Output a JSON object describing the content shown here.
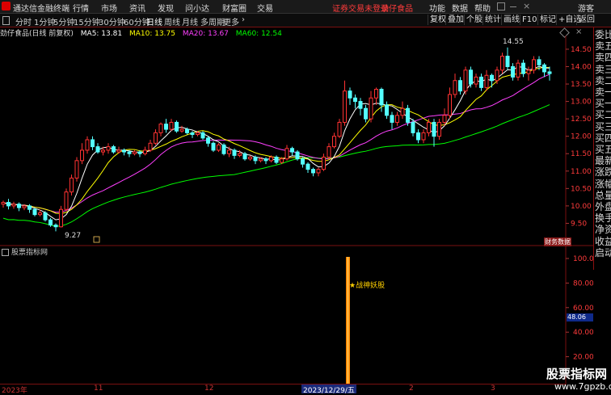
{
  "titlebar": {
    "app_title": "通达信金融终端",
    "menus": [
      "行情",
      "市场",
      "资讯",
      "发现",
      "问小达",
      "财富圈",
      "交易"
    ],
    "warning": "证券交易未登录",
    "stock_short": "劲仔食品",
    "right_items": [
      "功能",
      "数据",
      "帮助"
    ],
    "guest": "游客"
  },
  "toolbar": {
    "periods": [
      "分时",
      "1分钟",
      "5分钟",
      "15分钟",
      "30分钟",
      "60分钟",
      "日线",
      "周线",
      "月线",
      "多周期",
      "更多"
    ],
    "active_period": "日线",
    "right_buttons": [
      "复权",
      "叠加",
      "个股",
      "统计",
      "画线",
      "F10",
      "标记",
      "+自选",
      "返回"
    ]
  },
  "chart_header": {
    "stock_label": "劲仔食品(日线 前复权)",
    "ma5": "MA5: 13.81",
    "ma10": "MA10: 13.75",
    "ma20": "MA20: 13.67",
    "ma60": "MA60: 12.54",
    "colors": {
      "ma5": "#ffffff",
      "ma10": "#ffff00",
      "ma20": "#ff40ff",
      "ma60": "#00ff00"
    }
  },
  "right_panel": [
    "委比",
    "卖五",
    "卖四",
    "卖三",
    "卖二",
    "卖一",
    "买一",
    "买二",
    "买三",
    "买四",
    "买五",
    "最新",
    "涨跌",
    "涨幅",
    "总量",
    "外盘",
    "换手",
    "净资",
    "收益",
    "启动"
  ],
  "price_axis": [
    "14.50",
    "14.00",
    "13.50",
    "13.00",
    "12.50",
    "12.00",
    "11.50",
    "11.00",
    "10.50",
    "10.00",
    "9.50"
  ],
  "price_annotations": {
    "high": "14.55",
    "low": "9.27"
  },
  "caibao": "财务数据",
  "indicator": {
    "title": "股票指标网",
    "signal_text": "★战神妖股",
    "axis": [
      "100.00",
      "80.00",
      "60.00",
      "40.00",
      "20.00"
    ],
    "current_value": "48.06"
  },
  "dates": {
    "start": "2023年",
    "m11": "11",
    "m12": "12",
    "highlight": "2023/12/29/五",
    "m2": "2",
    "m3": "3"
  },
  "watermark": {
    "name": "股票指标网",
    "url": "www.7gpzb.com"
  },
  "chart_data": {
    "type": "candlestick",
    "price_range": [
      9.0,
      14.8
    ],
    "candles": [
      [
        10.05,
        10.1,
        9.95,
        10.15
      ],
      [
        10.1,
        10.0,
        9.9,
        10.2
      ],
      [
        10.0,
        10.05,
        9.92,
        10.12
      ],
      [
        10.05,
        9.95,
        9.85,
        10.1
      ],
      [
        9.95,
        10.0,
        9.88,
        10.05
      ],
      [
        10.0,
        9.9,
        9.8,
        10.05
      ],
      [
        9.9,
        9.75,
        9.7,
        9.95
      ],
      [
        9.75,
        9.8,
        9.7,
        9.9
      ],
      [
        9.8,
        9.6,
        9.55,
        9.85
      ],
      [
        9.6,
        9.45,
        9.4,
        9.65
      ],
      [
        9.45,
        9.4,
        9.27,
        9.5
      ],
      [
        9.4,
        9.9,
        9.38,
        10.0
      ],
      [
        9.9,
        10.4,
        9.85,
        10.5
      ],
      [
        10.4,
        10.8,
        10.3,
        10.9
      ],
      [
        10.8,
        11.3,
        10.7,
        11.4
      ],
      [
        11.3,
        11.6,
        11.2,
        11.8
      ],
      [
        11.6,
        11.9,
        11.5,
        12.0
      ],
      [
        11.9,
        11.7,
        11.6,
        12.0
      ],
      [
        11.7,
        11.55,
        11.5,
        11.8
      ],
      [
        11.55,
        11.6,
        11.45,
        11.7
      ],
      [
        11.6,
        11.7,
        11.5,
        11.8
      ],
      [
        11.7,
        11.55,
        11.5,
        11.75
      ],
      [
        11.55,
        11.6,
        11.5,
        11.7
      ],
      [
        11.6,
        11.55,
        11.45,
        11.65
      ],
      [
        11.55,
        11.5,
        11.4,
        11.6
      ],
      [
        11.5,
        11.55,
        11.45,
        11.6
      ],
      [
        11.55,
        11.5,
        11.4,
        11.6
      ],
      [
        11.5,
        11.6,
        11.45,
        11.7
      ],
      [
        11.6,
        11.8,
        11.55,
        11.9
      ],
      [
        11.8,
        12.1,
        11.75,
        12.2
      ],
      [
        12.1,
        12.35,
        12.0,
        12.4
      ],
      [
        12.35,
        12.2,
        12.1,
        12.5
      ],
      [
        12.2,
        12.4,
        12.15,
        12.5
      ],
      [
        12.4,
        12.15,
        12.1,
        12.45
      ],
      [
        12.15,
        12.2,
        12.1,
        12.3
      ],
      [
        12.2,
        12.1,
        12.05,
        12.25
      ],
      [
        12.1,
        12.05,
        11.95,
        12.15
      ],
      [
        12.05,
        12.1,
        12.0,
        12.15
      ],
      [
        12.1,
        11.95,
        11.9,
        12.15
      ],
      [
        11.95,
        11.8,
        11.7,
        12.0
      ],
      [
        11.8,
        11.6,
        11.55,
        11.85
      ],
      [
        11.6,
        11.75,
        11.55,
        11.8
      ],
      [
        11.75,
        11.5,
        11.45,
        11.8
      ],
      [
        11.5,
        11.6,
        11.4,
        11.7
      ],
      [
        11.6,
        11.45,
        11.35,
        11.65
      ],
      [
        11.45,
        11.5,
        11.4,
        11.6
      ],
      [
        11.5,
        11.35,
        11.3,
        11.55
      ],
      [
        11.35,
        11.4,
        11.3,
        11.45
      ],
      [
        11.4,
        11.3,
        11.2,
        11.45
      ],
      [
        11.3,
        11.35,
        11.25,
        11.4
      ],
      [
        11.35,
        11.3,
        11.2,
        11.4
      ],
      [
        11.3,
        11.4,
        11.25,
        11.45
      ],
      [
        11.4,
        11.25,
        11.2,
        11.45
      ],
      [
        11.25,
        11.35,
        11.2,
        11.4
      ],
      [
        11.35,
        11.65,
        11.3,
        11.75
      ],
      [
        11.65,
        11.55,
        11.45,
        11.7
      ],
      [
        11.55,
        11.35,
        11.3,
        11.6
      ],
      [
        11.35,
        11.2,
        11.1,
        11.4
      ],
      [
        11.2,
        11.05,
        10.95,
        11.25
      ],
      [
        11.05,
        10.95,
        10.85,
        11.1
      ],
      [
        10.95,
        11.05,
        10.85,
        11.1
      ],
      [
        11.05,
        11.4,
        11.0,
        11.5
      ],
      [
        11.4,
        11.7,
        11.35,
        11.8
      ],
      [
        11.7,
        12.0,
        11.65,
        12.1
      ],
      [
        12.0,
        12.4,
        11.95,
        12.5
      ],
      [
        12.4,
        13.3,
        12.3,
        13.6
      ],
      [
        13.3,
        13.1,
        12.9,
        13.4
      ],
      [
        13.1,
        13.0,
        12.8,
        13.2
      ],
      [
        13.0,
        12.8,
        12.6,
        13.1
      ],
      [
        12.8,
        12.5,
        12.4,
        12.9
      ],
      [
        12.5,
        13.1,
        12.4,
        13.3
      ],
      [
        13.1,
        13.35,
        12.9,
        13.4
      ],
      [
        13.35,
        12.9,
        12.7,
        13.4
      ],
      [
        12.9,
        12.6,
        12.5,
        13.0
      ],
      [
        12.6,
        12.4,
        12.2,
        12.7
      ],
      [
        12.4,
        12.6,
        12.3,
        12.7
      ],
      [
        12.6,
        12.8,
        12.5,
        13.0
      ],
      [
        12.8,
        12.4,
        12.3,
        12.9
      ],
      [
        12.4,
        12.1,
        12.0,
        12.5
      ],
      [
        12.1,
        11.9,
        11.8,
        12.2
      ],
      [
        11.9,
        12.1,
        11.8,
        12.2
      ],
      [
        12.1,
        12.4,
        12.0,
        12.5
      ],
      [
        12.4,
        12.0,
        11.7,
        12.5
      ],
      [
        12.0,
        12.4,
        11.9,
        12.5
      ],
      [
        12.4,
        12.6,
        12.3,
        12.8
      ],
      [
        12.6,
        13.2,
        12.5,
        13.4
      ],
      [
        13.2,
        13.6,
        13.1,
        13.8
      ],
      [
        13.6,
        13.3,
        13.2,
        13.7
      ],
      [
        13.3,
        13.9,
        13.2,
        14.0
      ],
      [
        13.9,
        13.5,
        13.4,
        14.0
      ],
      [
        13.5,
        13.7,
        13.4,
        13.8
      ],
      [
        13.7,
        13.4,
        13.3,
        13.8
      ],
      [
        13.4,
        13.75,
        13.3,
        13.9
      ],
      [
        13.75,
        13.6,
        13.4,
        13.8
      ],
      [
        13.6,
        13.9,
        13.5,
        14.0
      ],
      [
        13.9,
        14.3,
        13.8,
        14.4
      ],
      [
        14.3,
        14.0,
        13.9,
        14.55
      ],
      [
        14.0,
        13.7,
        13.6,
        14.1
      ],
      [
        13.7,
        14.1,
        13.6,
        14.2
      ],
      [
        14.1,
        13.8,
        13.7,
        14.2
      ],
      [
        13.8,
        13.9,
        13.6,
        14.0
      ],
      [
        13.9,
        14.2,
        13.8,
        14.3
      ],
      [
        14.2,
        14.05,
        13.9,
        14.3
      ],
      [
        14.05,
        13.85,
        13.7,
        14.1
      ],
      [
        13.85,
        13.8,
        13.6,
        14.0
      ]
    ]
  }
}
